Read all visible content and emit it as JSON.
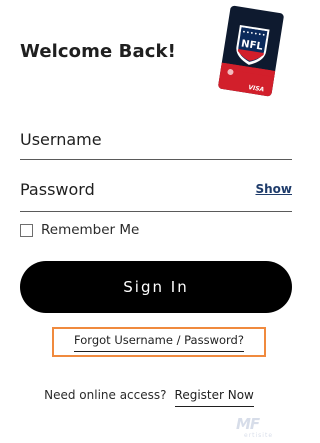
{
  "header": {
    "title": "Welcome Back!"
  },
  "card": {
    "logo_text": "NFL",
    "brand_text": "VISA"
  },
  "form": {
    "username_label": "Username",
    "password_label": "Password",
    "show_label": "Show",
    "remember_label": "Remember Me",
    "remember_checked": false,
    "signin_label": "Sign In",
    "forgot_label": "Forgot Username / Password?"
  },
  "footer": {
    "need_text": "Need online access?",
    "register_label": "Register Now"
  },
  "watermark": {
    "letters": "MF",
    "sub": "ertisite"
  },
  "colors": {
    "highlight_border": "#f08a3e",
    "button_bg": "#000000",
    "button_text": "#ffffff",
    "show_link": "#1f3c6b",
    "card_red": "#d21f2b",
    "card_navy": "#0b2a5b"
  }
}
